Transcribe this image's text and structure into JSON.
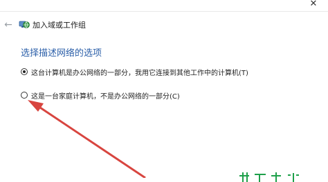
{
  "header": {
    "back_icon": "back-arrow-icon",
    "close_icon": "close-icon",
    "wizard_icon": "network-globe-icon",
    "title": "加入域或工作组"
  },
  "main": {
    "heading": "选择描述网络的选项",
    "options": [
      {
        "label": "这台计算机是办公网络的一部分，我用它连接到其他工作中的计算机(T)",
        "selected": true
      },
      {
        "label": "这是一台家庭计算机，不是办公网络的一部分(C)",
        "selected": false
      }
    ]
  },
  "annotation": {
    "arrow_color": "#d8453f",
    "watermark_color": "#1ea04a"
  }
}
